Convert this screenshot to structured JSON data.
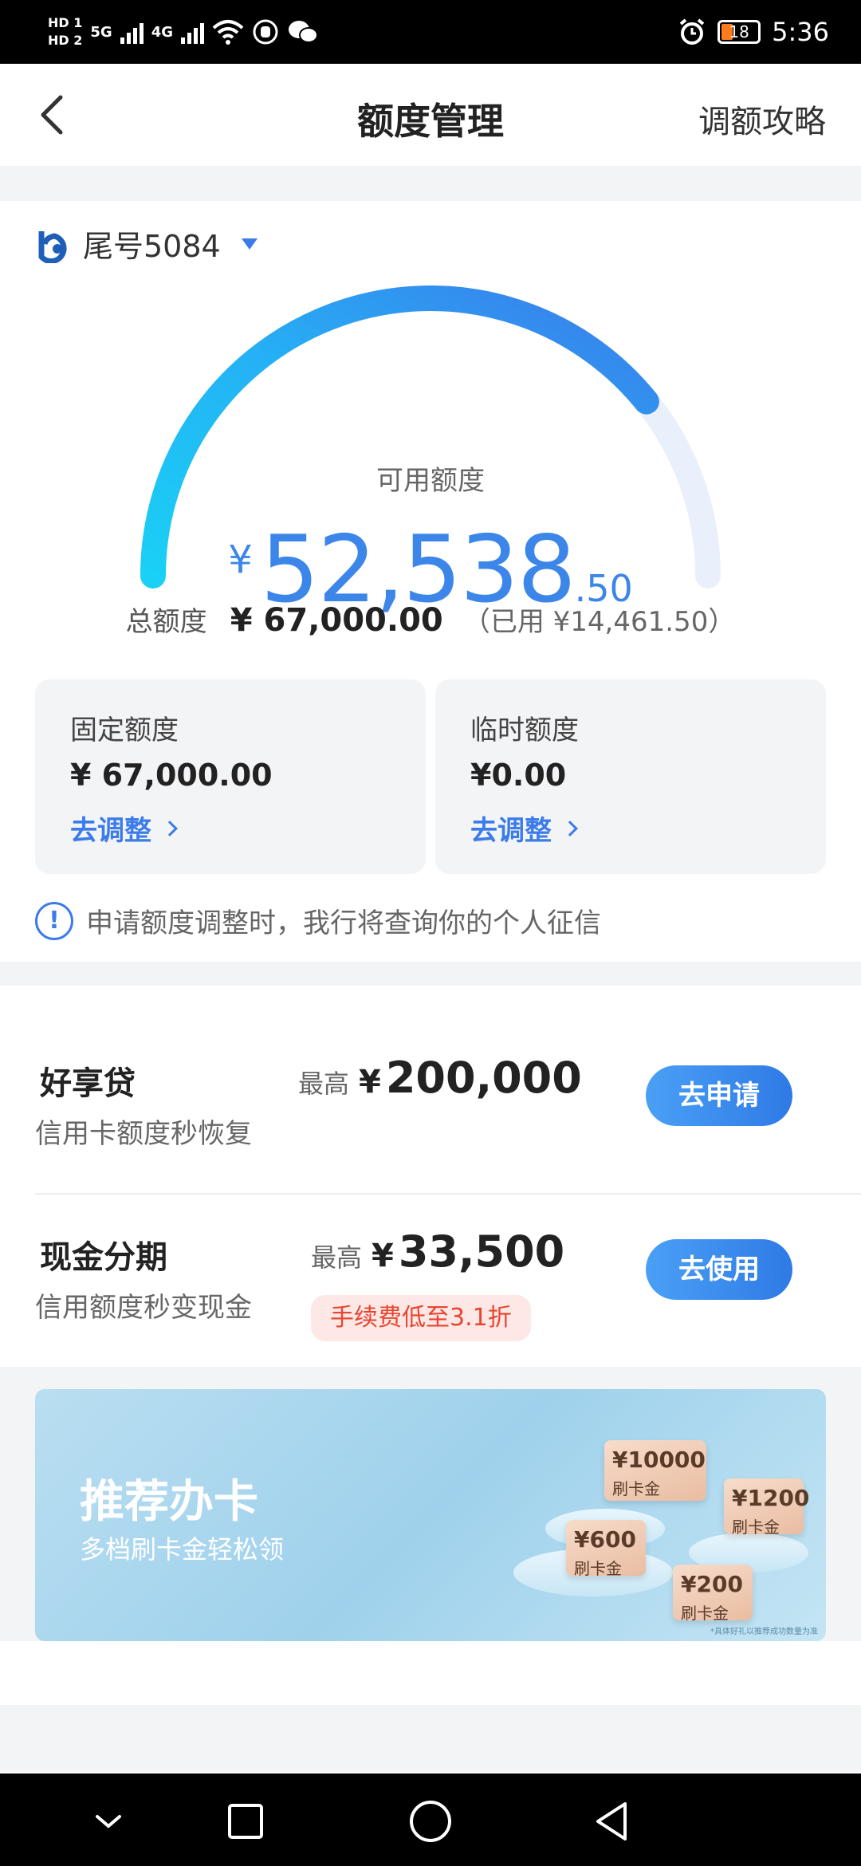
{
  "status_bar": {
    "sim1": "HD 1",
    "sim2": "HD 2",
    "net1": "5G",
    "net2": "4G",
    "battery": "18",
    "time": "5:36"
  },
  "nav": {
    "title": "额度管理",
    "right_link": "调额攻略"
  },
  "account": {
    "label": "尾号5084"
  },
  "credit": {
    "available_label": "可用额度",
    "currency": "¥",
    "available_int": "52,538",
    "available_dec": ".50",
    "available_fraction": 0.784,
    "total_label": "总额度",
    "total_amount": "¥ 67,000.00",
    "used_text": "（已用 ¥14,461.50）",
    "accent_color": "#3b86e8"
  },
  "quotas": {
    "fixed": {
      "title": "固定额度",
      "value": "¥ 67,000.00",
      "link": "去调整"
    },
    "temp": {
      "title": "临时额度",
      "value": "¥0.00",
      "link": "去调整"
    }
  },
  "notice": {
    "text": "申请额度调整时，我行将查询你的个人征信"
  },
  "products": [
    {
      "name": "好享贷",
      "desc": "信用卡额度秒恢复",
      "max_label": "最高",
      "currency": "¥",
      "max_value": "200,000",
      "button": "去申请"
    },
    {
      "name": "现金分期",
      "desc": "信用额度秒变现金",
      "max_label": "最高",
      "currency": "¥",
      "max_value": "33,500",
      "tag": "手续费低至3.1折",
      "button": "去使用"
    }
  ],
  "banner": {
    "title": "推荐办卡",
    "subtitle": "多档刷卡金轻松领",
    "coupons": [
      {
        "amount": "¥10000",
        "label": "刷卡金"
      },
      {
        "amount": "¥1200",
        "label": "刷卡金"
      },
      {
        "amount": "¥600",
        "label": "刷卡金"
      },
      {
        "amount": "¥200",
        "label": "刷卡金"
      }
    ],
    "note": "*具体好礼以推荐成功数量为准"
  }
}
